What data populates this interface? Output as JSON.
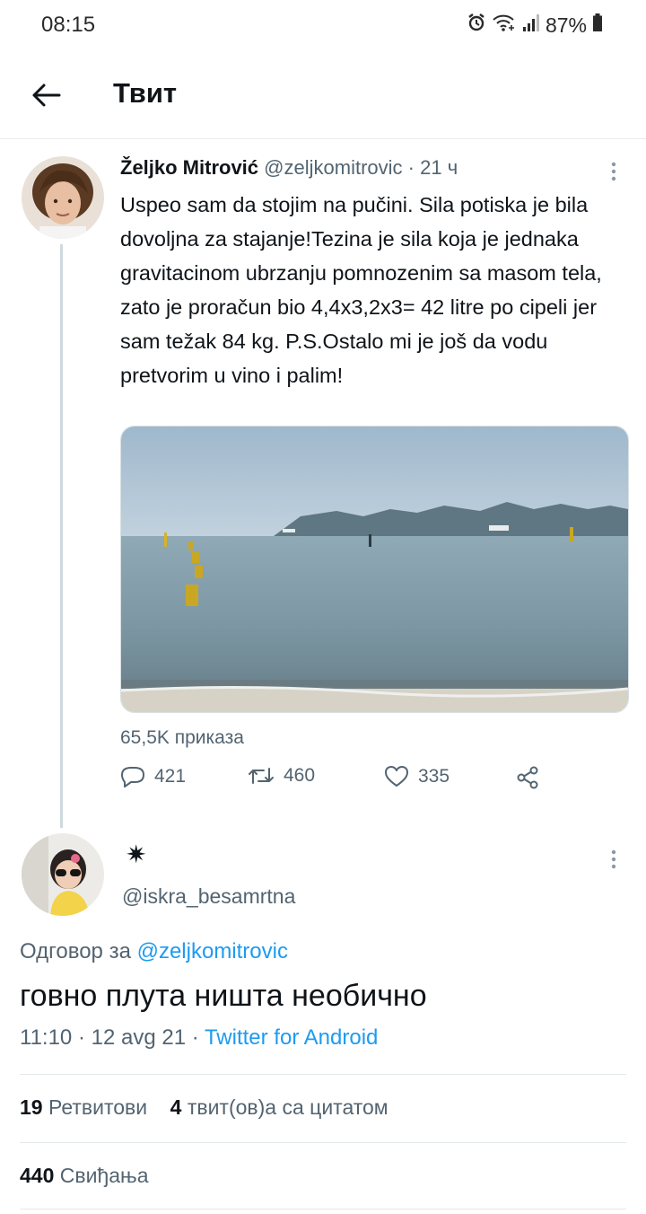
{
  "status_bar": {
    "time": "08:15",
    "battery": "87%",
    "icons": [
      "alarm-icon",
      "wifi-icon",
      "signal-icon",
      "battery-icon"
    ]
  },
  "header": {
    "title": "Твит",
    "back_icon": "arrow-left-icon"
  },
  "thread_tweet": {
    "name": "Željko Mitrović",
    "handle": "@zeljkomitrovic",
    "separator": "·",
    "time": "21 ч",
    "text": "Uspeo sam da stojim na pučini. Sila potiska je bila dovoljna za stajanje!Tezina je sila koja je jednaka gravitacinom ubrzanju pomnozenim sa masom tela, zato je proračun bio 4,4x3,2x3= 42 litre po cipeli jer sam težak 84 kg. P.S.Ostalo mi je još da vodu pretvorim u vino i palim!",
    "media_icon": "sea-photo",
    "views": "65,5K приказа",
    "replies": "421",
    "retweets": "460",
    "likes": "335"
  },
  "main_tweet": {
    "name": "✷",
    "handle": "@iskra_besamrtna",
    "reply_to_label": "Одговор за",
    "reply_to_handle": "@zeljkomitrovic",
    "text": "говно плута ништа необично",
    "time": "11:10",
    "date": "12 avg 21",
    "meta_separator": "·",
    "source": "Twitter for Android",
    "retweet_count": "19",
    "retweet_label": "Ретвитови",
    "quote_count": "4",
    "quote_label": "твит(ов)а са цитатом",
    "like_count": "440",
    "like_label": "Свиђања"
  },
  "colors": {
    "accent": "#1d9bf0",
    "secondary_text": "#536471",
    "primary_text": "#0f1419"
  }
}
